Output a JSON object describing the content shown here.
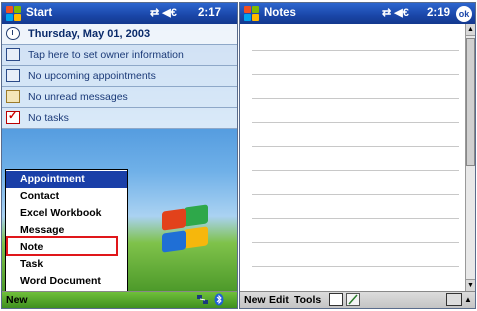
{
  "left_screen": {
    "title": "Start",
    "status_icons": "⇄ ◀€",
    "time": "2:17",
    "rows": [
      {
        "icon": "clock-icon",
        "text": "Thursday, May 01, 2003"
      },
      {
        "icon": "owner-card-icon",
        "text": "Tap here to set owner information"
      },
      {
        "icon": "calendar-icon",
        "text": "No upcoming appointments"
      },
      {
        "icon": "inbox-icon",
        "text": "No unread messages"
      },
      {
        "icon": "tasks-icon",
        "text": "No tasks"
      }
    ],
    "new_menu": {
      "items": [
        "Appointment",
        "Contact",
        "Excel Workbook",
        "Message",
        "Note",
        "Task",
        "Word Document"
      ],
      "selected": "Appointment",
      "highlighted": "Note"
    },
    "bottom_bar": {
      "new_label": "New"
    }
  },
  "right_screen": {
    "title": "Notes",
    "status_icons": "⇄ ◀€",
    "time": "2:19",
    "ok_label": "ok",
    "bottom_bar": {
      "new_label": "New",
      "edit_label": "Edit",
      "tools_label": "Tools"
    }
  }
}
